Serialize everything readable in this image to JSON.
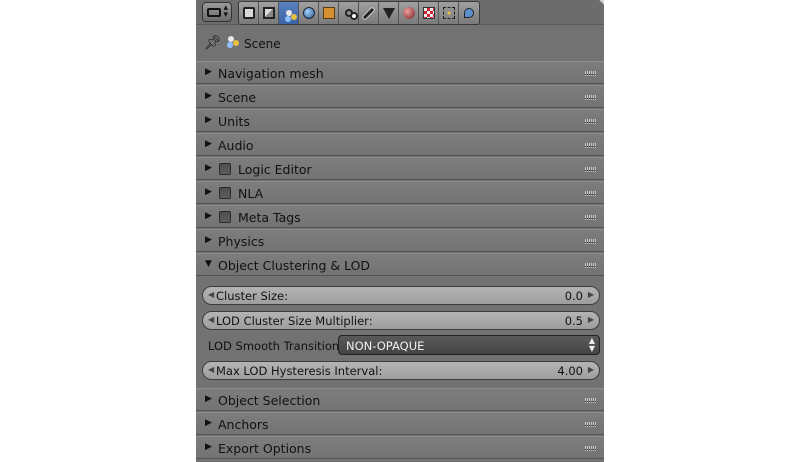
{
  "context": {
    "label": "Scene"
  },
  "panels": [
    {
      "label": "Navigation mesh",
      "expanded": false,
      "checkbox": false
    },
    {
      "label": "Scene",
      "expanded": false,
      "checkbox": false
    },
    {
      "label": "Units",
      "expanded": false,
      "checkbox": false
    },
    {
      "label": "Audio",
      "expanded": false,
      "checkbox": false
    },
    {
      "label": "Logic Editor",
      "expanded": false,
      "checkbox": true
    },
    {
      "label": "NLA",
      "expanded": false,
      "checkbox": true
    },
    {
      "label": "Meta Tags",
      "expanded": false,
      "checkbox": true
    },
    {
      "label": "Physics",
      "expanded": false,
      "checkbox": false
    },
    {
      "label": "Object Clustering & LOD",
      "expanded": true,
      "checkbox": false
    },
    {
      "label": "Object Selection",
      "expanded": false,
      "checkbox": false
    },
    {
      "label": "Anchors",
      "expanded": false,
      "checkbox": false
    },
    {
      "label": "Export Options",
      "expanded": false,
      "checkbox": false
    }
  ],
  "clustering": {
    "cluster_size": {
      "label": "Cluster Size:",
      "value": "0.0"
    },
    "lod_multiplier": {
      "label": "LOD Cluster Size Multiplier:",
      "value": "0.5"
    },
    "smooth_transitions": {
      "label": "LOD Smooth Transitions:",
      "value": "NON-OPAQUE"
    },
    "hysteresis": {
      "label": "Max LOD Hysteresis Interval:",
      "value": "4.00"
    }
  },
  "toolbar": {
    "tabs": [
      "render-icon",
      "render-layers-icon",
      "scene-icon",
      "world-icon",
      "object-icon",
      "constraints-icon",
      "modifiers-icon",
      "object-data-icon",
      "material-icon",
      "texture-icon",
      "particles-icon",
      "physics-icon"
    ],
    "active_tab": "scene-icon"
  }
}
